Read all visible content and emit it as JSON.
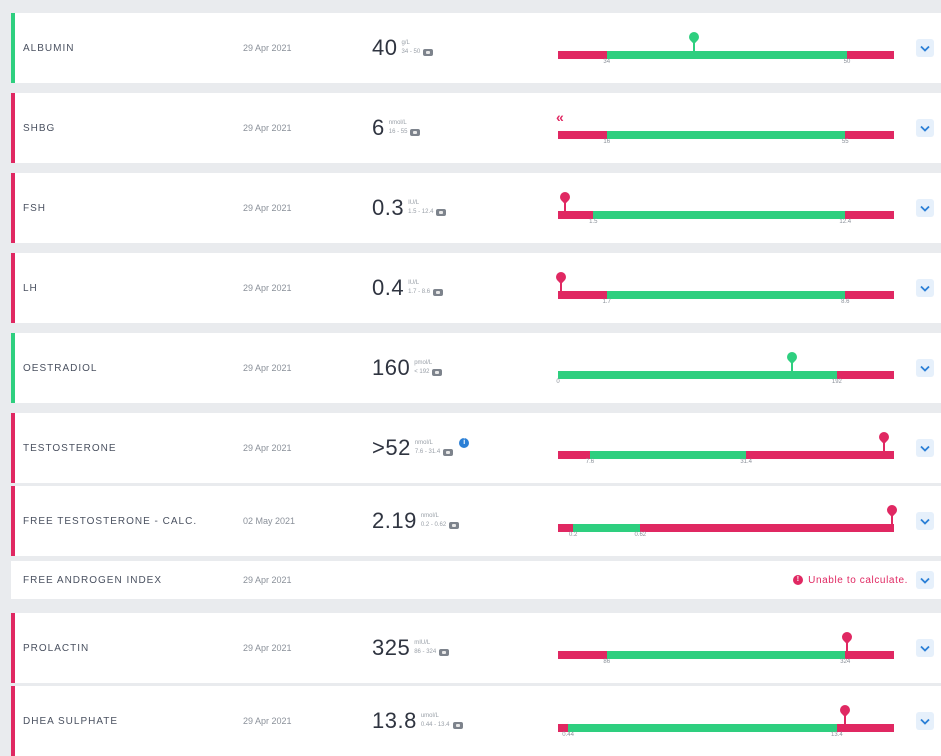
{
  "colors": {
    "normal": "#2ecf7f",
    "abnormal": "#e02862",
    "info": "#2a7fd6"
  },
  "rows": [
    {
      "name": "ALBUMIN",
      "date": "29 Apr 2021",
      "value": "40",
      "unit": "g/L",
      "range": "34 - 50",
      "status": "green",
      "bar": {
        "low": 34,
        "high": 50,
        "marker": 40,
        "marker_status": "green",
        "ticks": [
          "34",
          "50"
        ]
      }
    },
    {
      "name": "SHBG",
      "date": "29 Apr 2021",
      "value": "6",
      "unit": "nmol/L",
      "range": "16 - 55",
      "status": "red",
      "below_indicator": "«",
      "bar": {
        "low": 16,
        "high": 55,
        "marker": null,
        "ticks": [
          "16",
          "55"
        ]
      }
    },
    {
      "name": "FSH",
      "date": "29 Apr 2021",
      "value": "0.3",
      "unit": "IU/L",
      "range": "1.5 - 12.4",
      "status": "red",
      "bar": {
        "low": 1.5,
        "high": 12.4,
        "marker": 0.3,
        "marker_status": "red",
        "ticks": [
          "1.5",
          "12.4"
        ]
      }
    },
    {
      "name": "LH",
      "date": "29 Apr 2021",
      "value": "0.4",
      "unit": "IU/L",
      "range": "1.7 - 8.6",
      "status": "red",
      "bar": {
        "low": 1.7,
        "high": 8.6,
        "marker": 0.4,
        "marker_status": "red",
        "ticks": [
          "1.7",
          "8.6"
        ]
      }
    },
    {
      "name": "OESTRADIOL",
      "date": "29 Apr 2021",
      "value": "160",
      "unit": "pmol/L",
      "range": "< 192",
      "status": "green",
      "bar": {
        "low": 0,
        "high": 192,
        "marker": 160,
        "marker_status": "green",
        "ticks": [
          "0",
          "192"
        ]
      }
    },
    {
      "name": "TESTOSTERONE",
      "date": "29 Apr 2021",
      "value": ">52",
      "unit": "nmol/L",
      "range": "7.6 - 31.4",
      "status": "red",
      "info": "i",
      "bar": {
        "low": 7.6,
        "high": 31.4,
        "marker": 52,
        "marker_status": "red",
        "ticks": [
          "7.6",
          "31.4"
        ]
      }
    },
    {
      "name": "FREE TESTOSTERONE - CALC.",
      "date": "02 May 2021",
      "value": "2.19",
      "unit": "nmol/L",
      "range": "0.2 - 0.62",
      "status": "red",
      "bar": {
        "low": 0.2,
        "high": 0.62,
        "marker": 2.19,
        "marker_status": "red",
        "ticks": [
          "0.2",
          "0.62"
        ]
      }
    },
    {
      "name": "FREE ANDROGEN INDEX",
      "date": "29 Apr 2021",
      "status": "none",
      "error": "Unable to calculate.",
      "error_icon": "!"
    },
    {
      "name": "PROLACTIN",
      "date": "29 Apr 2021",
      "value": "325",
      "unit": "mIU/L",
      "range": "86 - 324",
      "status": "red",
      "bar": {
        "low": 86,
        "high": 324,
        "marker": 325,
        "marker_status": "red",
        "ticks": [
          "86",
          "324"
        ]
      }
    },
    {
      "name": "DHEA SULPHATE",
      "date": "29 Apr 2021",
      "value": "13.8",
      "unit": "umol/L",
      "range": "0.44 - 13.4",
      "status": "red",
      "bar": {
        "low": 0.44,
        "high": 13.4,
        "marker": 13.8,
        "marker_status": "red",
        "ticks": [
          "0.44",
          "13.4"
        ]
      }
    }
  ]
}
